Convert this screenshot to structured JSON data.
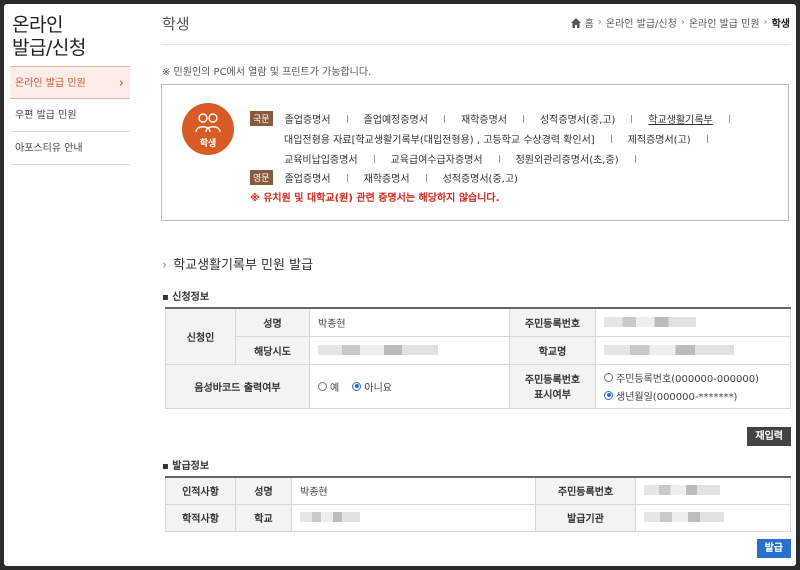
{
  "sidebar": {
    "title_line1": "온라인",
    "title_line2": "발급/신청",
    "items": [
      {
        "label": "온라인 발급 민원",
        "active": true
      },
      {
        "label": "우편 발급 민원",
        "active": false
      },
      {
        "label": "아포스티유 안내",
        "active": false
      }
    ]
  },
  "header": {
    "title": "학생",
    "breadcrumb": [
      "홈",
      "온라인 발급/신청",
      "온라인 발급 민원",
      "학생"
    ]
  },
  "notice": "※ 민원인의 PC에서 열람 및 프린트가 가능합니다.",
  "certs": {
    "badge_label": "학생",
    "korean_tag": "국문",
    "english_tag": "영문",
    "row1": [
      "졸업증명서",
      "졸업예정증명서",
      "재학증명서",
      "성적증명서(중,고)",
      "학교생활기록부"
    ],
    "row2": [
      "대입전형용 자료[학교생활기록부(대입전형용) , 고등학교 수상경력 확인서]",
      "제적증명서(고)"
    ],
    "row3": [
      "교육비납입증명서",
      "교육급여수급자증명서",
      "정원외관리증명서(초,중)"
    ],
    "english": [
      "졸업증명서",
      "재학증명서",
      "성적증명서(중,고)"
    ],
    "warning": "※ 유치원 및 대학교(원) 관련 증명서는 해당하지 않습니다."
  },
  "section_title": "학교생활기록부 민원 발급",
  "application": {
    "subtitle": "신청정보",
    "applicant_label": "신청인",
    "name_label": "성명",
    "name_value": "박종현",
    "rrn_label": "주민등록번호",
    "region_label": "해당시도",
    "school_label": "학교명",
    "barcode_label": "음성바코드 출력여부",
    "barcode_yes": "예",
    "barcode_no": "아니요",
    "rrn_display_label_1": "주민등록번호",
    "rrn_display_label_2": "표시여부",
    "rrn_option_full": "주민등록번호(000000-000000)",
    "rrn_option_birth": "생년월일(000000-*******)"
  },
  "reinput_button": "재입력",
  "issue_info": {
    "subtitle": "발급정보",
    "personal_label": "인적사항",
    "name_label": "성명",
    "name_value": "박종현",
    "rrn_label": "주민등록번호",
    "school_record_label": "학적사항",
    "school_label": "학교",
    "issuer_label": "발급기관"
  },
  "issue_button": "발급",
  "colors": {
    "accent": "#d85a24",
    "link_blue": "#2a6fc9",
    "warning": "#d42a1e"
  }
}
